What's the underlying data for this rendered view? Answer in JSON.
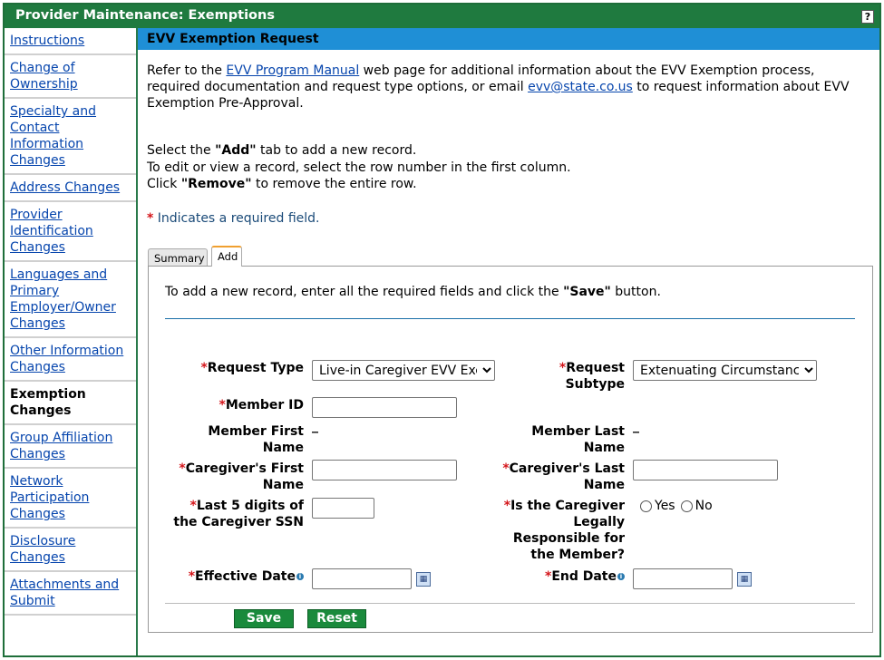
{
  "window": {
    "title": "Provider Maintenance: Exemptions",
    "help_label": "?"
  },
  "sidebar": {
    "items": [
      {
        "label": "Instructions",
        "active": false
      },
      {
        "label": "Change of Ownership",
        "active": false
      },
      {
        "label": "Specialty and Contact Information Changes",
        "active": false
      },
      {
        "label": "Address Changes",
        "active": false
      },
      {
        "label": "Provider Identification Changes",
        "active": false
      },
      {
        "label": "Languages and Primary Employer/Owner Changes",
        "active": false
      },
      {
        "label": "Other Information Changes",
        "active": false
      },
      {
        "label": "Exemption Changes",
        "active": true
      },
      {
        "label": "Group Affiliation Changes",
        "active": false
      },
      {
        "label": "Network Participation Changes",
        "active": false
      },
      {
        "label": "Disclosure Changes",
        "active": false
      },
      {
        "label": "Attachments and Submit",
        "active": false
      }
    ]
  },
  "section": {
    "title": "EVV Exemption Request"
  },
  "intro": {
    "p1_a": "Refer to the ",
    "manual_link": "EVV Program Manual",
    "p1_b": " web page for additional information about the EVV Exemption process, required documentation and request type options, or email ",
    "email_link": "evv@state.co.us",
    "p1_c": " to request information about EVV Exemption Pre-Approval."
  },
  "instructions": {
    "line1_a": "Select the ",
    "line1_b": "\"Add\"",
    "line1_c": " tab to add a new record.",
    "line2": "To edit or view a record, select the row number in the first column.",
    "line3_a": "Click ",
    "line3_b": "\"Remove\"",
    "line3_c": " to remove the entire row."
  },
  "required_note": {
    "star": "*",
    "text": " Indicates a required field."
  },
  "tabs": [
    {
      "label": "Summary"
    },
    {
      "label": "Add"
    }
  ],
  "form": {
    "intro_a": "To add a new record, enter all the required fields and click the ",
    "intro_b": "\"Save\"",
    "intro_c": " button.",
    "star": "*",
    "request_type": {
      "label": "Request Type",
      "value": "Live-in Caregiver EVV Exemption"
    },
    "request_subtype": {
      "label": "Request Subtype",
      "value": "Extenuating Circumstances"
    },
    "member_id": {
      "label": "Member ID",
      "value": ""
    },
    "member_first": {
      "label": "Member First Name",
      "value": "_"
    },
    "member_last": {
      "label": "Member Last Name",
      "value": "_"
    },
    "caregiver_first": {
      "label": "Caregiver's First Name",
      "value": ""
    },
    "caregiver_last": {
      "label": "Caregiver's Last Name",
      "value": ""
    },
    "ssn": {
      "label": "Last 5 digits of the Caregiver SSN",
      "value": ""
    },
    "legally": {
      "label": "Is the Caregiver Legally Responsible for the Member?",
      "yes": "Yes",
      "no": "No"
    },
    "effective_date": {
      "label": "Effective Date",
      "value": ""
    },
    "end_date": {
      "label": "End Date",
      "value": ""
    }
  },
  "buttons": {
    "save": "Save",
    "reset": "Reset"
  }
}
